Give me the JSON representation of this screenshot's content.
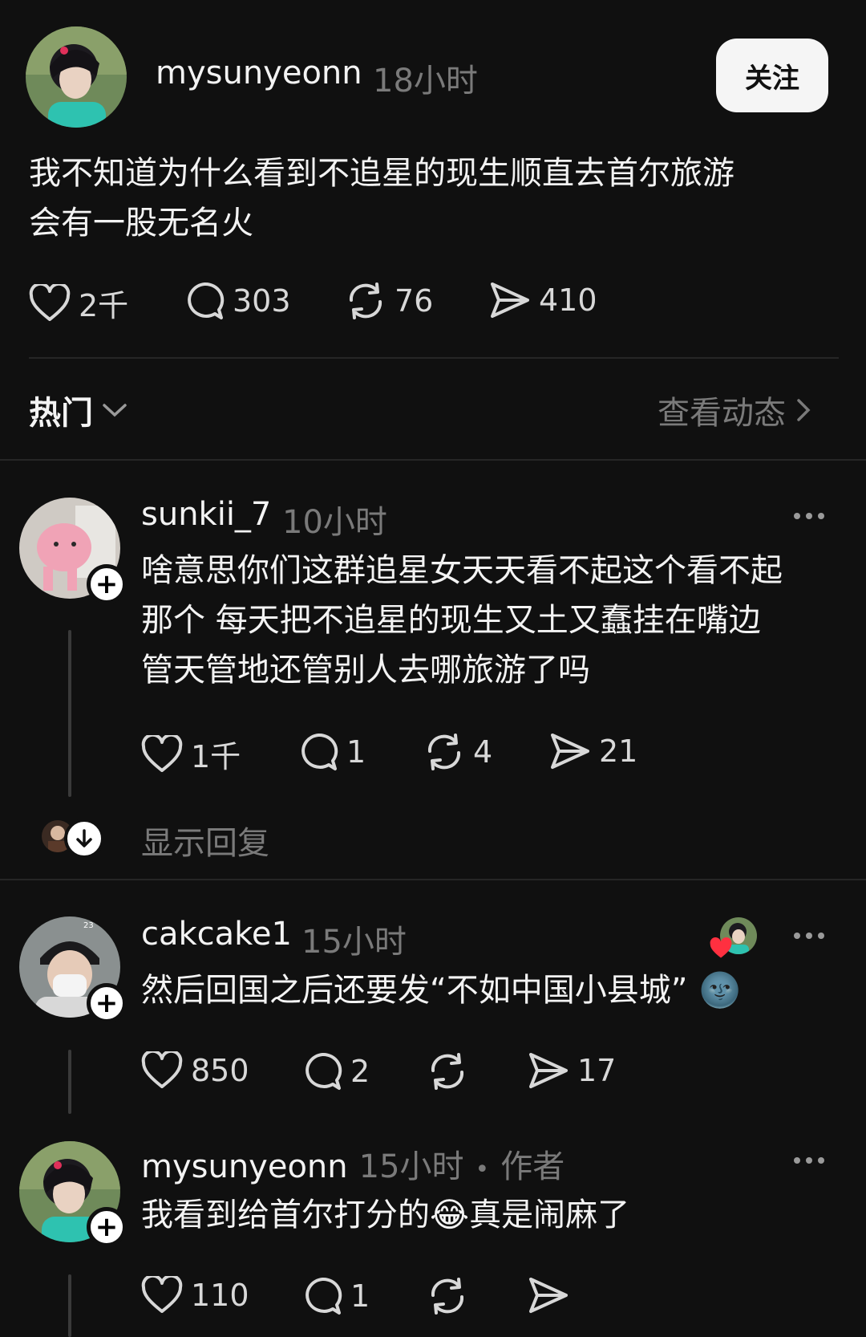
{
  "post": {
    "author": "mysunyeonn",
    "time": "18小时",
    "follow_label": "关注",
    "text_line1": "我不知道为什么看到不追星的现生顺直去首尔旅游",
    "text_line2": "会有一股无名火",
    "likes": "2千",
    "comments": "303",
    "reposts": "76",
    "shares": "410"
  },
  "sort": {
    "label": "热门",
    "view_activity": "查看动态"
  },
  "comments": [
    {
      "author": "sunkii_7",
      "time": "10小时",
      "line1": "啥意思你们这群追星女天天看不起这个看不起",
      "line2": "那个 每天把不追星的现生又土又蠢挂在嘴边",
      "line3": "管天管地还管别人去哪旅游了吗",
      "likes": "1千",
      "comments": "1",
      "reposts": "4",
      "shares": "21",
      "show_replies": "显示回复"
    },
    {
      "author": "cakcake1",
      "time": "15小时",
      "line1": "然后回国之后还要发“不如中国小县城”",
      "emoji": "🌚",
      "likes": "850",
      "comments": "2",
      "shares": "17"
    },
    {
      "author": "mysunyeonn",
      "time": "15小时",
      "separator": "•",
      "author_tag": "作者",
      "line1a": "我看到给首尔打分的",
      "emoji": "😂",
      "line1b": "真是闹麻了",
      "likes": "110",
      "comments": "1"
    }
  ],
  "colors": {
    "background": "#101010",
    "muted_text": "#7a7a7a",
    "heart_red": "#ff3040"
  },
  "icons": [
    "heart-icon",
    "comment-icon",
    "repost-icon",
    "share-icon",
    "more-icon",
    "chevron-down-icon",
    "chevron-right-icon",
    "plus-icon",
    "arrow-down-icon"
  ]
}
